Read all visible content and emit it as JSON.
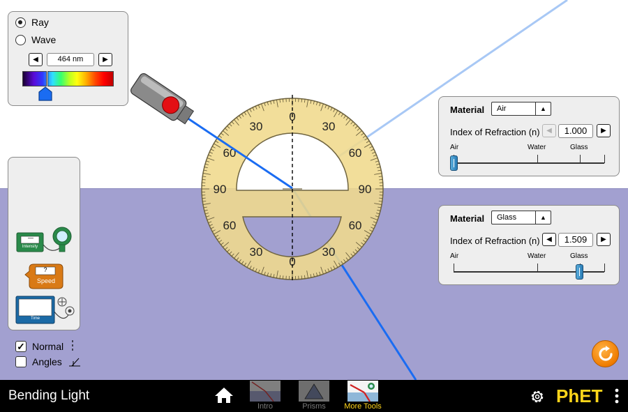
{
  "app": {
    "title": "Bending Light",
    "accent_color": "#ffd51a",
    "top_medium_color": "#ffffff",
    "bottom_medium_color": "#a2a0d0",
    "beam_color": "#1a6cf2"
  },
  "light_type": {
    "ray_label": "Ray",
    "wave_label": "Wave",
    "selected": "Ray",
    "wavelength": "464 nm",
    "decrease_icon": "left-triangle",
    "increase_icon": "right-triangle"
  },
  "top_medium": {
    "material_label": "Material",
    "material_value": "Air",
    "ior_label": "Index of Refraction (n)",
    "ior_value": "1.000",
    "tick_air": "Air",
    "tick_water": "Water",
    "tick_glass": "Glass"
  },
  "bottom_medium": {
    "material_label": "Material",
    "material_value": "Glass",
    "ior_label": "Index of Refraction (n)",
    "ior_value": "1.509",
    "tick_air": "Air",
    "tick_water": "Water",
    "tick_glass": "Glass"
  },
  "tools": {
    "intensity_label": "Intensity",
    "intensity_value": "—",
    "speed_label": "Speed",
    "speed_value": "?",
    "time_label": "Time",
    "normal_label": "Normal",
    "normal_checked": true,
    "angles_label": "Angles",
    "angles_checked": false
  },
  "protractor": {
    "labels": [
      "0",
      "30",
      "30",
      "60",
      "60",
      "90",
      "90",
      "60",
      "60",
      "30",
      "30",
      "0"
    ]
  },
  "navbar": {
    "screens": [
      {
        "label": "Intro",
        "active": false
      },
      {
        "label": "Prisms",
        "active": false
      },
      {
        "label": "More Tools",
        "active": true
      }
    ],
    "logo": "PhET"
  }
}
